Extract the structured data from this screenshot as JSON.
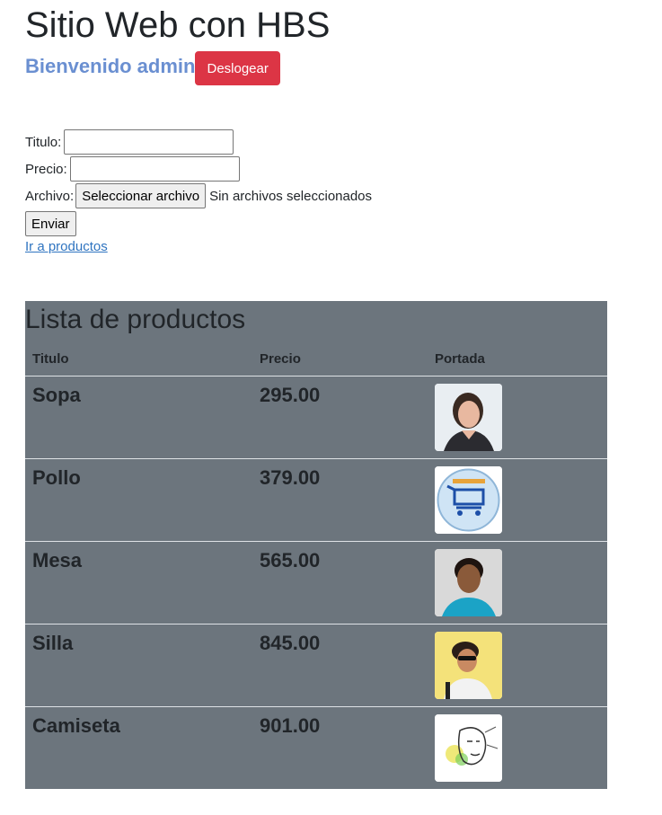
{
  "header": {
    "title": "Sitio Web con HBS",
    "welcome": "Bienvenido admin",
    "logout_label": "Deslogear"
  },
  "form": {
    "titulo_label": "Titulo:",
    "titulo_value": "",
    "precio_label": "Precio:",
    "precio_value": "",
    "archivo_label": "Archivo:",
    "file_button": "Seleccionar archivo",
    "file_status": "Sin archivos seleccionados",
    "submit_label": "Enviar",
    "link_label": "Ir a productos"
  },
  "products": {
    "title": "Lista de productos",
    "columns": [
      "Titulo",
      "Precio",
      "Portada"
    ],
    "rows": [
      {
        "titulo": "Sopa",
        "precio": "295.00",
        "portada": "woman-portrait-image"
      },
      {
        "titulo": "Pollo",
        "precio": "379.00",
        "portada": "shopping-cart-logo-image"
      },
      {
        "titulo": "Mesa",
        "precio": "565.00",
        "portada": "man-portrait-image"
      },
      {
        "titulo": "Silla",
        "precio": "845.00",
        "portada": "man-sunglasses-image"
      },
      {
        "titulo": "Camiseta",
        "precio": "901.00",
        "portada": "sketch-face-image"
      }
    ]
  },
  "colors": {
    "welcome": "#6a8fd1",
    "danger": "#dc3545",
    "table_bg": "#6c757d",
    "link": "#2f74c0"
  }
}
